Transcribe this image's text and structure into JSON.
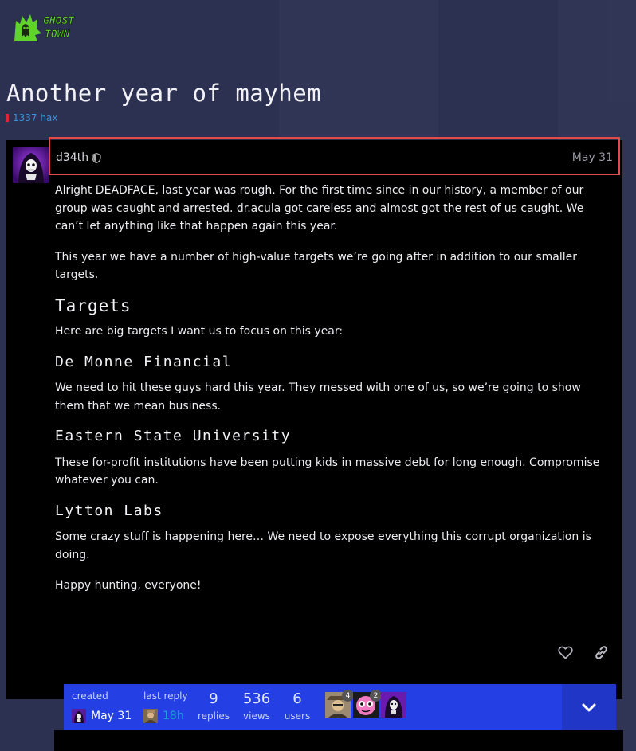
{
  "site": {
    "logo_line1": "GHOST",
    "logo_line2": "TOWN"
  },
  "topic": {
    "title": "Another year of mayhem",
    "category": "1337 hax",
    "category_color": "#e0243b"
  },
  "post": {
    "author": "d34th",
    "date": "May 31",
    "body": {
      "intro1": "Alright DEADFACE, last year was rough. For the first time since in our history, a member of our group was caught and arrested. dr.acula got careless and almost got the rest of us caught. We can’t let anything like that happen again this year.",
      "intro2": "This year we have a number of high-value targets we’re going after in addition to our smaller targets.",
      "targets_heading": "Targets",
      "targets_intro": "Here are big targets I want us to focus on this year:",
      "target1_heading": "De Monne Financial",
      "target1_text": "We need to hit these guys hard this year. They messed with one of us, so we’re going to show them that we mean business.",
      "target2_heading": "Eastern State University",
      "target2_text": "These for-profit institutions have been putting kids in massive debt for long enough. Compromise whatever you can.",
      "target3_heading": "Lytton Labs",
      "target3_text": "Some crazy stuff is happening here… We need to expose everything this corrupt organization is doing.",
      "closing": "Happy hunting, everyone!"
    },
    "actions": {
      "like_icon": "heart-icon",
      "share_icon": "link-icon"
    }
  },
  "topic_map": {
    "created_label": "created",
    "created_value": "May 31",
    "last_reply_label": "last reply",
    "last_reply_value": "18h",
    "replies_count": "9",
    "replies_label": "replies",
    "views_count": "536",
    "views_label": "views",
    "users_count": "6",
    "users_label": "users",
    "participants": [
      {
        "count": "4"
      },
      {
        "count": "2"
      },
      {
        "count": ""
      }
    ],
    "accent_color": "#2440e4"
  }
}
